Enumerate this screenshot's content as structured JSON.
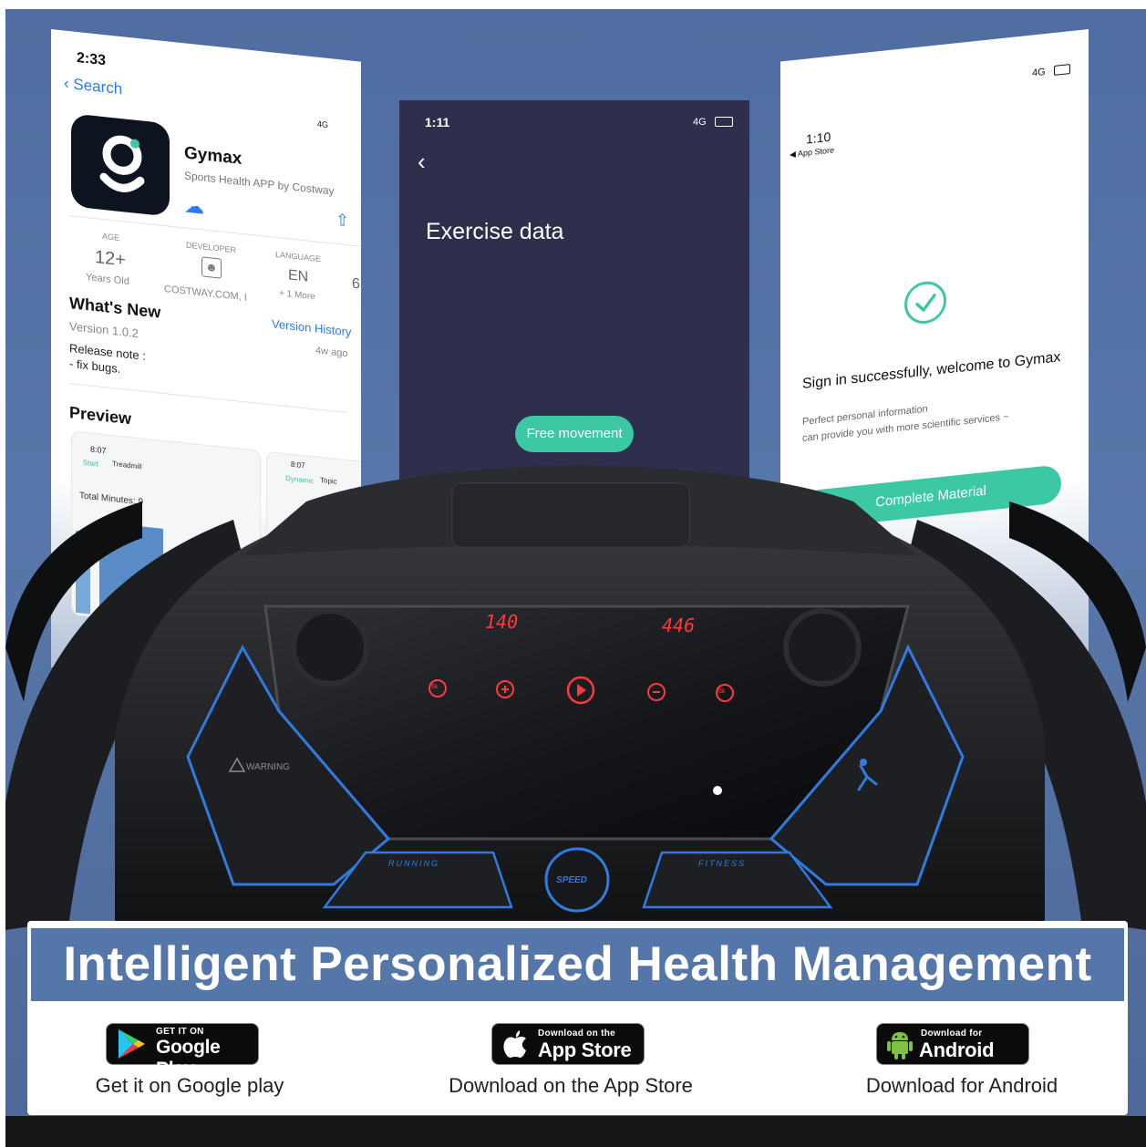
{
  "left_phone": {
    "time": "2:33",
    "back_label": "Search",
    "signal": "4G",
    "app_name": "Gymax",
    "app_subtitle": "Sports Health APP by Costway",
    "age_label": "AGE",
    "age_value": "12+",
    "age_sub": "Years Old",
    "developer_label": "DEVELOPER",
    "developer_value": "COSTWAY.COM, I",
    "language_label": "LANGUAGE",
    "language_value": "EN",
    "language_sub": "+ 1 More",
    "extra_col": "6",
    "whats_new": "What's New",
    "version_history": "Version History",
    "version": "Version 1.0.2",
    "ago": "4w ago",
    "release_note": "Release note :",
    "release_item": "- fix bugs.",
    "preview": "Preview",
    "preview_time": "8:07",
    "preview_time2": "8:07",
    "preview_tab_start": "Start",
    "preview_tab_treadmill": "Treadmill",
    "preview_tab_dynamic": "Dynamic",
    "preview_tab_topic": "Topic",
    "preview_total": "Total Minutes: 9"
  },
  "mid_phone": {
    "time": "1:11",
    "signal": "4G",
    "title": "Exercise data",
    "button": "Free movement"
  },
  "right_phone": {
    "time": "1:10",
    "back_label": "App Store",
    "signal": "4G",
    "headline": "Sign in successfully, welcome to Gymax",
    "sub1": "Perfect personal information",
    "sub2": "can provide you with more scientific services ~",
    "button": "Complete Material"
  },
  "console": {
    "display_left": "140",
    "display_right": "446",
    "warning": "WARNING",
    "speed_label": "SPEED",
    "running_label": "RUNNING",
    "fitness_label": "FITNESS",
    "key_6k_left": "6k",
    "key_6k_right": "6k"
  },
  "banner": {
    "title": "Intelligent Personalized Health Management",
    "google": {
      "small": "GET IT ON",
      "big": "Google Play",
      "caption": "Get it on Google play"
    },
    "apple": {
      "small": "Download on the",
      "big": "App Store",
      "caption": "Download on the App Store"
    },
    "android": {
      "small": "Download for",
      "big": "Android",
      "caption": "Download for Android"
    }
  },
  "colors": {
    "background": "#5576a8",
    "accent_green": "#3cc8a2",
    "console_blue": "#2f7be0",
    "display_red": "#ff3a3a"
  }
}
